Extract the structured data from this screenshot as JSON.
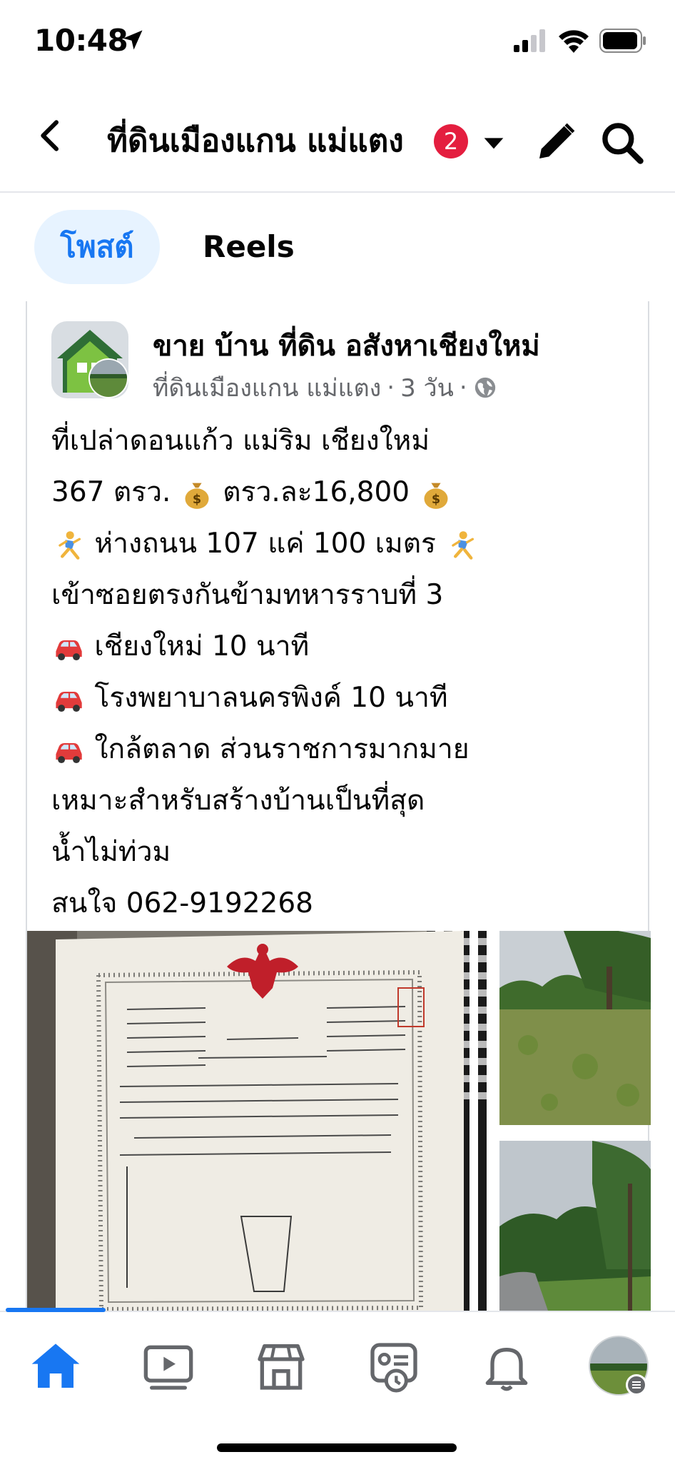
{
  "status_bar": {
    "time": "10:48",
    "icons": [
      "location-arrow-icon",
      "cellular-signal-icon",
      "wifi-icon",
      "battery-icon"
    ]
  },
  "header": {
    "title": "ที่ดินเมืองแกน แม่แตง",
    "badge_count": "2",
    "icons": [
      "back-icon",
      "chevron-down-icon",
      "pencil-icon",
      "search-icon"
    ]
  },
  "tabs": [
    {
      "label": "โพสต์",
      "active": true
    },
    {
      "label": "Reels",
      "active": false
    }
  ],
  "post": {
    "author": "ขาย บ้าน ที่ดิน อสังหาเชียงใหม่",
    "group": "ที่ดินเมืองแกน แม่แตง",
    "separator": "·",
    "time": "3 วัน",
    "lines": {
      "l1": "ที่เปล่าดอนแก้ว แม่ริม เชียงใหม่",
      "l2a": "367 ตรว.",
      "l2b": "ตรว.ละ16,800",
      "l3": "ห่างถนน 107 แค่ 100 เมตร",
      "l4": "เข้าซอยตรงกันข้ามทหารราบที่ 3",
      "l5": "เชียงใหม่ 10 นาที",
      "l6": "โรงพยาบาลนครพิงค์ 10 นาที",
      "l7": "ใกล้ตลาด ส่วนราชการมากมาย",
      "l8": "เหมาะสำหรับสร้างบ้านเป็นที่สุด",
      "l9": "น้ำไม่ท่วม",
      "l10": "สนใจ 062-9192268"
    },
    "emoji": [
      "money-bag-icon",
      "runner-icon",
      "car-icon"
    ]
  },
  "bottom_nav": {
    "items": [
      "home-icon",
      "video-icon",
      "marketplace-icon",
      "feeds-icon",
      "bell-icon",
      "profile-avatar"
    ],
    "active": "home-icon"
  },
  "colors": {
    "accent": "#1877f2",
    "badge": "#e41e3f",
    "tab_bg": "#e7f3ff",
    "meta_text": "#65676b"
  }
}
